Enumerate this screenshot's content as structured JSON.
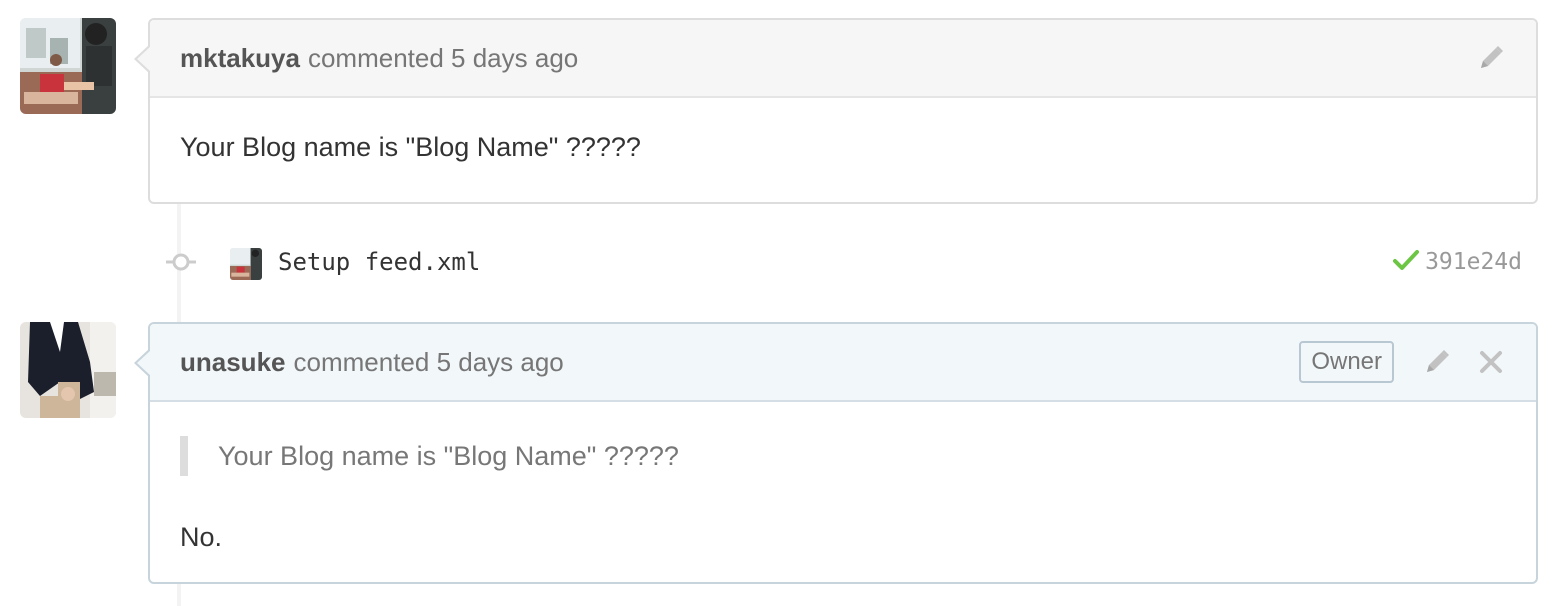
{
  "comments": [
    {
      "author": "mktakuya",
      "action": "commented 5 days ago",
      "body": "Your Blog name is \"Blog Name\" ?????"
    },
    {
      "author": "unasuke",
      "action": "commented 5 days ago",
      "badge": "Owner",
      "quote": "Your Blog name is \"Blog Name\" ?????",
      "body": "No."
    }
  ],
  "commit": {
    "message": "Setup feed.xml",
    "sha": "391e24d",
    "status": "success",
    "status_icon": "check-icon"
  },
  "colors": {
    "success": "#6cc644",
    "owner_header_bg": "#f2f7fa",
    "header_bg": "#f6f6f6"
  }
}
